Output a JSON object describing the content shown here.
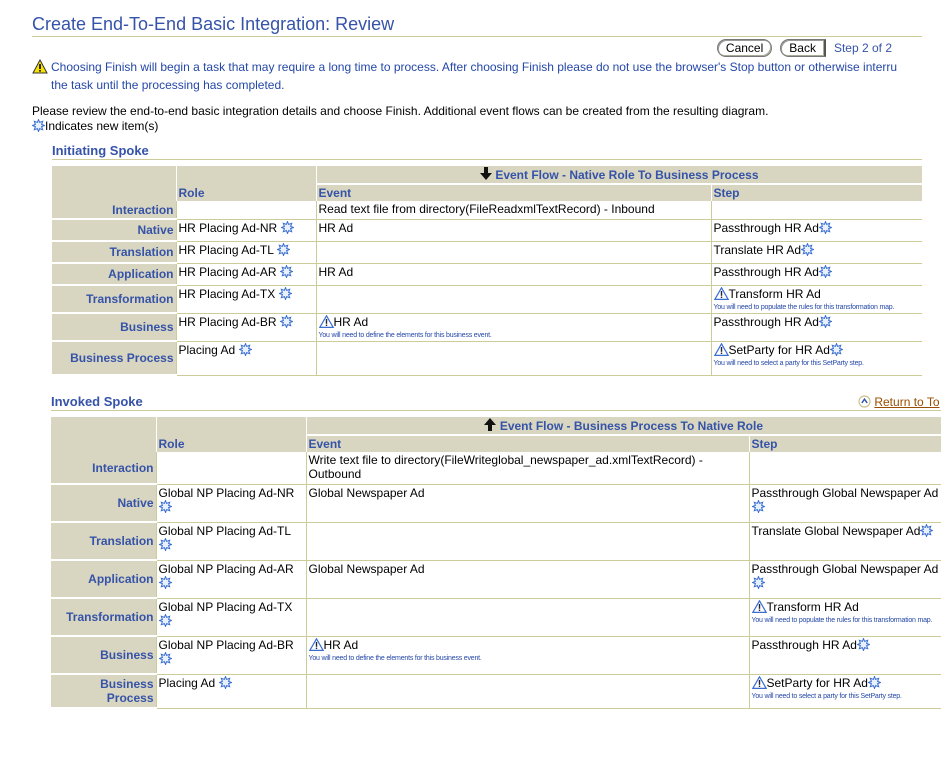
{
  "page": {
    "title": "Create End-To-End Basic Integration: Review",
    "buttons": {
      "cancel": "Cancel",
      "back": "Back"
    },
    "step_info": "Step 2 of 2",
    "warning": {
      "icon": "warning-icon",
      "line1": "Choosing Finish will begin a task that may require a long time to process. After choosing Finish please do not use the browser's Stop button or otherwise interru",
      "line2": "the task until the processing has completed."
    },
    "intro": "Please review the end-to-end basic integration details and choose Finish. Additional event flows can be created from the resulting diagram.",
    "legend": {
      "icon": "new-item-icon",
      "text": "Indicates new item(s)"
    },
    "return_link": "Return to To"
  },
  "initiating": {
    "title": "Initiating Spoke",
    "flow_header": "Event Flow - Native Role To Business Process",
    "flow_icon": "arrow-down-icon",
    "columns": {
      "role": "Role",
      "event": "Event",
      "step": "Step"
    },
    "rows": [
      {
        "label": "Interaction",
        "role": "",
        "role_new": false,
        "event": "Read text file from directory(FileReadxmlTextRecord) - Inbound",
        "event_warn": false,
        "event_note": "",
        "step": "",
        "step_warn": false,
        "step_new": false,
        "step_note": ""
      },
      {
        "label": "Native",
        "role": "HR Placing Ad-NR",
        "role_new": true,
        "event": "HR Ad",
        "event_warn": false,
        "event_note": "",
        "step": "Passthrough HR Ad",
        "step_warn": false,
        "step_new": true,
        "step_note": ""
      },
      {
        "label": "Translation",
        "role": "HR Placing Ad-TL",
        "role_new": true,
        "event": "",
        "event_warn": false,
        "event_note": "",
        "step": "Translate HR Ad",
        "step_warn": false,
        "step_new": true,
        "step_note": ""
      },
      {
        "label": "Application",
        "role": "HR Placing Ad-AR",
        "role_new": true,
        "event": "HR Ad",
        "event_warn": false,
        "event_note": "",
        "step": "Passthrough HR Ad",
        "step_warn": false,
        "step_new": true,
        "step_note": ""
      },
      {
        "label": "Transformation",
        "role": "HR Placing Ad-TX",
        "role_new": true,
        "event": "",
        "event_warn": false,
        "event_note": "",
        "step": "Transform HR Ad",
        "step_warn": true,
        "step_new": false,
        "step_note": "You will need to populate the rules for this transformation map."
      },
      {
        "label": "Business",
        "role": "HR Placing Ad-BR",
        "role_new": true,
        "event": "HR Ad",
        "event_warn": true,
        "event_note": "You will need to define the elements for this business event.",
        "step": "Passthrough HR Ad",
        "step_warn": false,
        "step_new": true,
        "step_note": ""
      },
      {
        "label": "Business Process",
        "role": "Placing Ad",
        "role_new": true,
        "event": "",
        "event_warn": false,
        "event_note": "",
        "step": "SetParty for HR Ad",
        "step_warn": true,
        "step_new": true,
        "step_note": "You will need to select a party for this SetParty step."
      }
    ]
  },
  "invoked": {
    "title": "Invoked Spoke",
    "flow_header": "Event Flow - Business Process To Native Role",
    "flow_icon": "arrow-up-icon",
    "columns": {
      "role": "Role",
      "event": "Event",
      "step": "Step"
    },
    "rows": [
      {
        "label": "Interaction",
        "role": "",
        "role_new": false,
        "event": "Write text file to directory(FileWriteglobal_newspaper_ad.xmlTextRecord) - Outbound",
        "event_warn": false,
        "event_note": "",
        "step": "",
        "step_warn": false,
        "step_new": false,
        "step_note": ""
      },
      {
        "label": "Native",
        "role": "Global NP Placing Ad-NR",
        "role_new": true,
        "event": "Global Newspaper Ad",
        "event_warn": false,
        "event_note": "",
        "step": "Passthrough Global Newspaper Ad",
        "step_warn": false,
        "step_new": true,
        "step_note": ""
      },
      {
        "label": "Translation",
        "role": "Global NP Placing Ad-TL",
        "role_new": true,
        "event": "",
        "event_warn": false,
        "event_note": "",
        "step": "Translate Global Newspaper Ad",
        "step_warn": false,
        "step_new": true,
        "step_note": ""
      },
      {
        "label": "Application",
        "role": "Global NP Placing Ad-AR",
        "role_new": true,
        "event": "Global Newspaper Ad",
        "event_warn": false,
        "event_note": "",
        "step": "Passthrough Global Newspaper Ad",
        "step_warn": false,
        "step_new": true,
        "step_note": ""
      },
      {
        "label": "Transformation",
        "role": "Global NP Placing Ad-TX",
        "role_new": true,
        "event": "",
        "event_warn": false,
        "event_note": "",
        "step": "Transform HR Ad",
        "step_warn": true,
        "step_new": false,
        "step_note": "You will need to populate the rules for this transformation map."
      },
      {
        "label": "Business",
        "role": "Global NP Placing Ad-BR",
        "role_new": true,
        "event": "HR Ad",
        "event_warn": true,
        "event_note": "You will need to define the elements for this business event.",
        "step": "Passthrough HR Ad",
        "step_warn": false,
        "step_new": true,
        "step_note": ""
      },
      {
        "label": "Business Process",
        "role": "Placing Ad",
        "role_new": true,
        "event": "",
        "event_warn": false,
        "event_note": "",
        "step": "SetParty for HR Ad",
        "step_warn": true,
        "step_new": true,
        "step_note": "You will need to select a party for this SetParty step."
      }
    ]
  }
}
